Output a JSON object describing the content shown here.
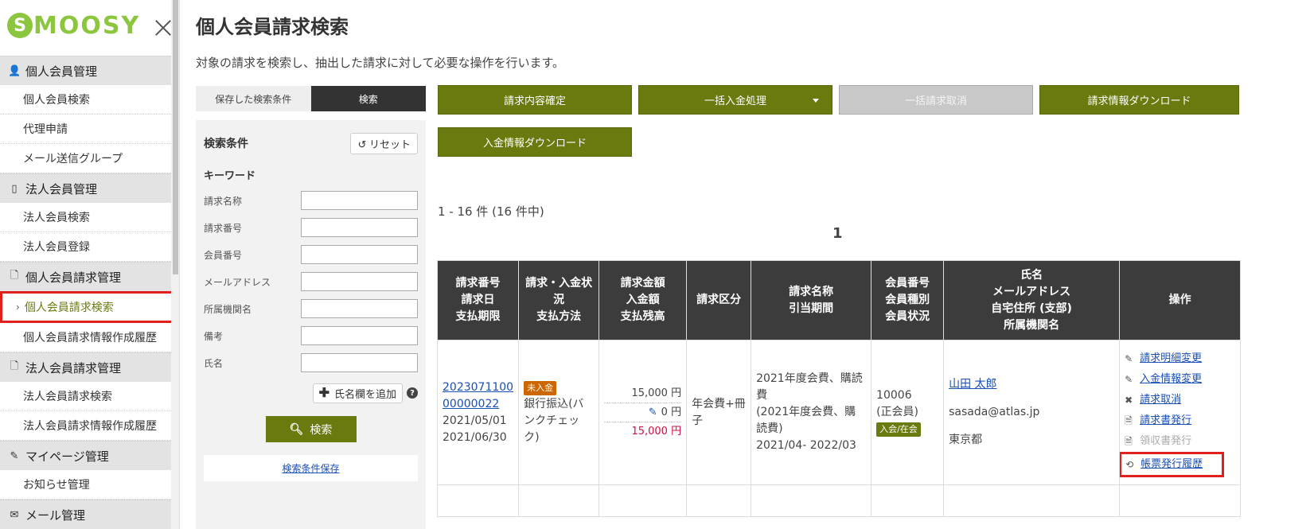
{
  "logo": {
    "letter": "S",
    "text": "MOOSY"
  },
  "sidebar": {
    "groups": [
      {
        "icon": "person-icon",
        "glyph": "👤",
        "title": "個人会員管理",
        "items": [
          "個人会員検索",
          "代理申請",
          "メール送信グループ"
        ]
      },
      {
        "icon": "building-icon",
        "glyph": "▯",
        "title": "法人会員管理",
        "items": [
          "法人会員検索",
          "法人会員登録"
        ]
      },
      {
        "icon": "document-icon",
        "glyph": "🗋",
        "title": "個人会員請求管理",
        "items": [
          "個人会員請求検索",
          "個人会員請求情報作成履歴"
        ]
      },
      {
        "icon": "document-icon",
        "glyph": "🗋",
        "title": "法人会員請求管理",
        "items": [
          "法人会員請求検索",
          "法人会員請求情報作成履歴"
        ]
      },
      {
        "icon": "pen-icon",
        "glyph": "✎",
        "title": "マイページ管理",
        "items": [
          "お知らせ管理"
        ]
      },
      {
        "icon": "mail-icon",
        "glyph": "✉",
        "title": "メール管理",
        "items": []
      }
    ],
    "active_item": "個人会員請求検索"
  },
  "page": {
    "title": "個人会員請求検索",
    "description": "対象の請求を検索し、抽出した請求に対して必要な操作を行います。"
  },
  "search": {
    "tab_saved": "保存した検索条件",
    "tab_search": "検索",
    "cond_title": "検索条件",
    "reset_label": "リセット",
    "keyword_title": "キーワード",
    "fields": [
      {
        "label": "請求名称",
        "value": ""
      },
      {
        "label": "請求番号",
        "value": ""
      },
      {
        "label": "会員番号",
        "value": ""
      },
      {
        "label": "メールアドレス",
        "value": ""
      },
      {
        "label": "所属機関名",
        "value": ""
      },
      {
        "label": "備考",
        "value": ""
      },
      {
        "label": "氏名",
        "value": ""
      }
    ],
    "add_name_label": "氏名欄を追加",
    "help_glyph": "?",
    "search_label": "検索",
    "save_label": "検索条件保存"
  },
  "actions": {
    "confirm": "請求内容確定",
    "bulk_payment": "一括入金処理",
    "bulk_cancel": "一括請求取消",
    "invoice_download": "請求情報ダウンロード",
    "payment_download": "入金情報ダウンロード"
  },
  "results": {
    "count_text": "1 - 16 件 (16 件中)",
    "current_page": "1",
    "headers": [
      [
        "請求番号",
        "請求日",
        "支払期限"
      ],
      [
        "請求・入金状",
        "況",
        "支払方法"
      ],
      [
        "請求金額",
        "入金額",
        "支払残高"
      ],
      [
        "請求区分"
      ],
      [
        "請求名称",
        "引当期間"
      ],
      [
        "会員番号",
        "会員種別",
        "会員状況"
      ],
      [
        "氏名",
        "メールアドレス",
        "自宅住所 (支部)",
        "所属機関名"
      ],
      [
        "操作"
      ]
    ],
    "rows": [
      {
        "invoice_no_1": "2023071100",
        "invoice_no_2": "00000022",
        "invoice_date": "2021/05/01",
        "due_date": "2021/06/30",
        "status_badge": "未入金",
        "pay_method": "銀行振込(バンクチェック)",
        "amount": "15,000 円",
        "paid": "0 円",
        "balance": "15,000 円",
        "category": "年会費+冊子",
        "name_line1": "2021年度会費、購読費",
        "name_line2": "(2021年度会費、購読費)",
        "period": "2021/04- 2022/03",
        "member_no": "10006",
        "member_type": "(正会員)",
        "member_status": "入会/在会",
        "person_name": "山田 太郎",
        "email": "sasada@atlas.jp",
        "address": "東京都",
        "ops": [
          {
            "icon": "pencil-icon",
            "glyph": "✎",
            "label": "請求明細変更",
            "enabled": true
          },
          {
            "icon": "pencil-icon",
            "glyph": "✎",
            "label": "入金情報変更",
            "enabled": true
          },
          {
            "icon": "x-icon",
            "glyph": "✖",
            "label": "請求取消",
            "enabled": true
          },
          {
            "icon": "document-icon",
            "glyph": "🗎",
            "label": "請求書発行",
            "enabled": true
          },
          {
            "icon": "document-icon",
            "glyph": "🗎",
            "label": "領収書発行",
            "enabled": false
          },
          {
            "icon": "history-icon",
            "glyph": "⟲",
            "label": "帳票発行履歴",
            "enabled": true
          }
        ]
      }
    ]
  }
}
